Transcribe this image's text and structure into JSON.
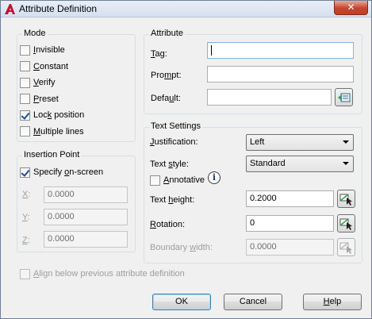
{
  "window": {
    "title": "Attribute Definition",
    "close_glyph": "✕"
  },
  "mode": {
    "title": "Mode",
    "items": [
      {
        "pre": "",
        "key": "I",
        "post": "nvisible",
        "checked": false
      },
      {
        "pre": "",
        "key": "C",
        "post": "onstant",
        "checked": false
      },
      {
        "pre": "",
        "key": "V",
        "post": "erify",
        "checked": false
      },
      {
        "pre": "",
        "key": "P",
        "post": "reset",
        "checked": false
      },
      {
        "pre": "Loc",
        "key": "k",
        "post": " position",
        "checked": true
      },
      {
        "pre": "",
        "key": "M",
        "post": "ultiple lines",
        "checked": false
      }
    ]
  },
  "insertion": {
    "title": "Insertion Point",
    "specify": {
      "pre": "Specify ",
      "key": "o",
      "post": "n-screen",
      "checked": true
    },
    "x": {
      "key": "X",
      "post": ":",
      "value": "0.0000"
    },
    "y": {
      "key": "Y",
      "post": ":",
      "value": "0.0000"
    },
    "z": {
      "key": "Z",
      "post": ":",
      "value": "0.0000"
    }
  },
  "attribute": {
    "title": "Attribute",
    "tag": {
      "key": "T",
      "post": "ag:",
      "value": ""
    },
    "prompt": {
      "pre": "Pro",
      "key": "m",
      "post": "pt:",
      "value": ""
    },
    "default": {
      "pre": "Defa",
      "key": "u",
      "post": "lt:",
      "value": ""
    }
  },
  "text_settings": {
    "title": "Text Settings",
    "justification": {
      "pre": "",
      "key": "J",
      "post": "ustification:",
      "value": "Left"
    },
    "text_style": {
      "pre": "Text ",
      "key": "s",
      "post": "tyle:",
      "value": "Standard"
    },
    "annotative": {
      "pre": "",
      "key": "A",
      "post": "nnotative",
      "checked": false,
      "info_glyph": "i"
    },
    "text_height": {
      "pre": "Text ",
      "key": "h",
      "post": "eight:",
      "value": "0.2000"
    },
    "rotation": {
      "pre": "",
      "key": "R",
      "post": "otation:",
      "value": "0"
    },
    "boundary_width": {
      "pre": "Boundary ",
      "key": "w",
      "post": "idth:",
      "value": "0.0000"
    }
  },
  "align": {
    "pre": "",
    "key": "A",
    "post": "lign below previous attribute definition",
    "checked": false
  },
  "buttons": {
    "ok": "OK",
    "cancel": "Cancel",
    "help_key": "H",
    "help_post": "elp"
  }
}
